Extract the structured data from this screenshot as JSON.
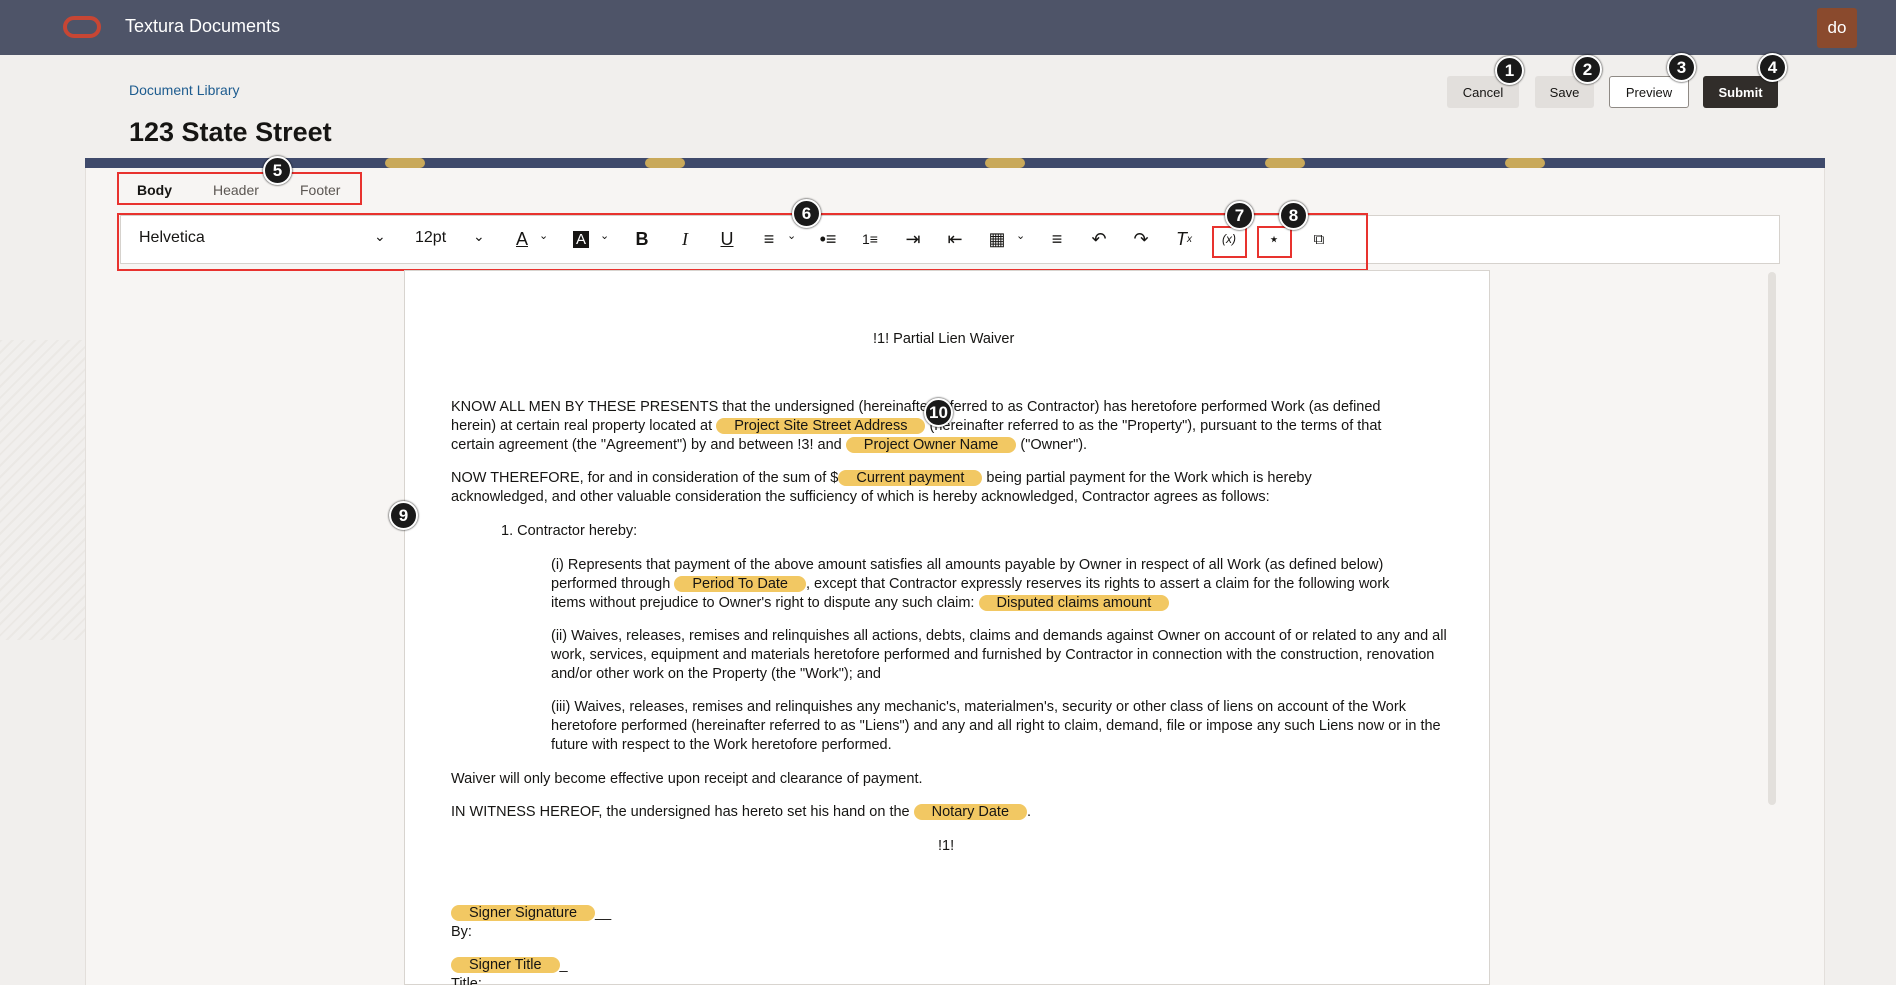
{
  "app": {
    "title": "Textura Documents",
    "user_initials": "do"
  },
  "breadcrumb": "Document Library",
  "page_title": "123 State Street",
  "actions": {
    "cancel": "Cancel",
    "save": "Save",
    "preview": "Preview",
    "submit": "Submit"
  },
  "tabs": {
    "body": "Body",
    "header": "Header",
    "footer": "Footer",
    "active": "Body"
  },
  "toolbar": {
    "font": "Helvetica",
    "size": "12pt",
    "icons": [
      "font-color-icon",
      "highlight-color-icon",
      "bold-icon",
      "italic-icon",
      "underline-icon",
      "align-icon",
      "bulleted-list-icon",
      "numbered-list-icon",
      "indent-icon",
      "outdent-icon",
      "table-icon",
      "page-break-icon",
      "undo-icon",
      "redo-icon",
      "clear-formatting-icon",
      "insert-variable-icon",
      "conditional-icon",
      "source-icon"
    ]
  },
  "callouts": [
    "1",
    "2",
    "3",
    "4",
    "5",
    "6",
    "7",
    "8",
    "9",
    "10"
  ],
  "document": {
    "title": "!1! Partial Lien Waiver",
    "p1_a": "KNOW ALL MEN BY THESE PRESENTS that the undersigned (hereinafter referred to as Contractor) has heretofore performed Work (as defined",
    "p1_b": "herein) at certain real property located at",
    "p1_field1": "Project Site Street Address",
    "p1_c": "(hereinafter referred to as the \"Property\"), pursuant to the terms of that",
    "p1_d": "certain agreement (the \"Agreement\") by and between !3! and",
    "p1_field2": "Project Owner Name",
    "p1_e": "(\"Owner\").",
    "p2_a": "NOW THEREFORE, for and in consideration of the sum of $",
    "p2_field": "Current payment",
    "p2_b": "being partial payment for the Work which is hereby",
    "p2_c": "acknowledged, and other valuable consideration the sufficiency of which is hereby acknowledged, Contractor agrees as follows:",
    "item1": "1. Contractor hereby:",
    "i_a": "(i) Represents that payment of the above amount satisfies all amounts payable by Owner in respect of all Work (as defined below)",
    "i_b": "performed through",
    "i_field1": "Period To Date",
    "i_c": ", except that Contractor expressly reserves its rights to assert a claim for the following work",
    "i_d": "items without prejudice to Owner's right to dispute any such claim:",
    "i_field2": "Disputed claims amount",
    "ii": "(ii) Waives, releases, remises and relinquishes all actions, debts, claims and demands against Owner on account of or related to any and all work, services, equipment and materials heretofore performed and furnished by Contractor in connection with the construction, renovation and/or other work on the Property (the \"Work\"); and",
    "iii": "(iii) Waives, releases, remises and relinquishes any mechanic's, materialmen's, security or other class of liens on account of the Work heretofore performed (hereinafter referred to as \"Liens\") and any and all right to claim, demand, file or impose any such Liens now or in the future with respect to the Work heretofore performed.",
    "waiver": "Waiver will only become effective upon receipt and clearance of payment.",
    "witness_a": "IN WITNESS HEREOF, the undersigned has hereto set his hand on the",
    "witness_field": "Notary Date",
    "witness_b": ".",
    "end_marker": "!1!",
    "sig_field": "Signer Signature",
    "sig_tail": "__",
    "by": "By:",
    "title_field": "Signer Title",
    "title_tail": "_",
    "title_label": "Title:"
  },
  "colors": {
    "topbar": "#4e5468",
    "field_highlight": "#f2c863",
    "callout_box": "#e8322e",
    "submit": "#312d2a"
  }
}
